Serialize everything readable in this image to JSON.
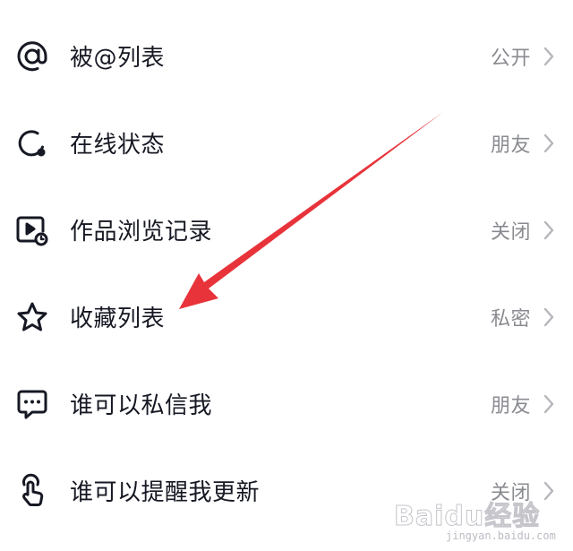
{
  "rows": [
    {
      "label": "被@列表",
      "value": "公开",
      "icon": "at-icon"
    },
    {
      "label": "在线状态",
      "value": "朋友",
      "icon": "online-status-icon"
    },
    {
      "label": "作品浏览记录",
      "value": "关闭",
      "icon": "video-history-icon"
    },
    {
      "label": "收藏列表",
      "value": "私密",
      "icon": "star-icon"
    },
    {
      "label": "谁可以私信我",
      "value": "朋友",
      "icon": "message-icon"
    },
    {
      "label": "谁可以提醒我更新",
      "value": "关闭",
      "icon": "finger-tap-icon"
    }
  ],
  "watermark": {
    "brand": "Baidu经验",
    "url": "jingyan.baidu.com"
  },
  "colors": {
    "label": "#161823",
    "value": "#8a8b91",
    "chevron": "#b5b6ba",
    "arrow": "#e8333a"
  }
}
